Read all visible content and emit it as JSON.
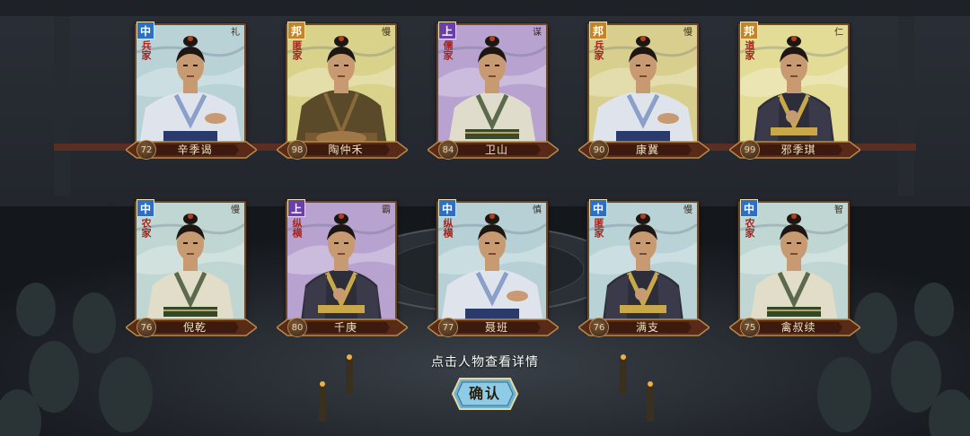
{
  "hint_text": "点击人物查看详情",
  "confirm_label": "确认",
  "colors": {
    "rank_zhong": "#2c6fc4",
    "rank_bang": "#c2852a",
    "rank_shang": "#6a3fa8",
    "school_text": "#a8241c",
    "plate": "#5a2a18"
  },
  "characters": [
    {
      "rank": "中",
      "rank_style": "blue",
      "school": "兵家",
      "trait": "礼",
      "score": "72",
      "name": "辛季谒",
      "bg": "#b8d2d6",
      "robe": "#dfe4ec",
      "sash": "#2a3a6a",
      "build": "wide"
    },
    {
      "rank": "邦",
      "rank_style": "gold",
      "school": "匿家",
      "trait": "慢",
      "score": "98",
      "name": "陶仲禾",
      "bg": "#d8d28a",
      "robe": "#5a4a2a",
      "sash": "#3a2a18",
      "build": "heavy"
    },
    {
      "rank": "上",
      "rank_style": "purple",
      "school": "儒家",
      "trait": "谋",
      "score": "84",
      "name": "卫山",
      "bg": "#b8a2d0",
      "robe": "#e0dccc",
      "sash": "#3a4a2a",
      "build": "slim"
    },
    {
      "rank": "邦",
      "rank_style": "gold",
      "school": "兵家",
      "trait": "慢",
      "score": "90",
      "name": "康冀",
      "bg": "#d8cf8e",
      "robe": "#dfe4ec",
      "sash": "#2a3a6a",
      "build": "wide"
    },
    {
      "rank": "邦",
      "rank_style": "gold",
      "school": "道家",
      "trait": "仁",
      "score": "99",
      "name": "邪季琪",
      "bg": "#e2dc96",
      "robe": "#2e2e3a",
      "sash": "#c8a84a",
      "build": "fighter"
    },
    {
      "rank": "中",
      "rank_style": "blue",
      "school": "农家",
      "trait": "慢",
      "score": "76",
      "name": "倪乾",
      "bg": "#c0d6d2",
      "robe": "#e2ddc8",
      "sash": "#2e4a2a",
      "build": "slim"
    },
    {
      "rank": "上",
      "rank_style": "purple",
      "school": "纵横",
      "trait": "霸",
      "score": "80",
      "name": "千庚",
      "bg": "#b8a2d0",
      "robe": "#2e2e3a",
      "sash": "#c8a84a",
      "build": "fighter"
    },
    {
      "rank": "中",
      "rank_style": "blue",
      "school": "纵横",
      "trait": "慎",
      "score": "77",
      "name": "聂班",
      "bg": "#b6d0d6",
      "robe": "#dfe4ec",
      "sash": "#2a3a6a",
      "build": "wide"
    },
    {
      "rank": "中",
      "rank_style": "blue",
      "school": "匿家",
      "trait": "慢",
      "score": "76",
      "name": "满支",
      "bg": "#b8d2d6",
      "robe": "#2e2e3a",
      "sash": "#c8a84a",
      "build": "fighter"
    },
    {
      "rank": "中",
      "rank_style": "blue",
      "school": "农家",
      "trait": "智",
      "score": "75",
      "name": "禽叔续",
      "bg": "#c0d6d2",
      "robe": "#e2ddc8",
      "sash": "#2e4a2a",
      "build": "slim"
    }
  ]
}
